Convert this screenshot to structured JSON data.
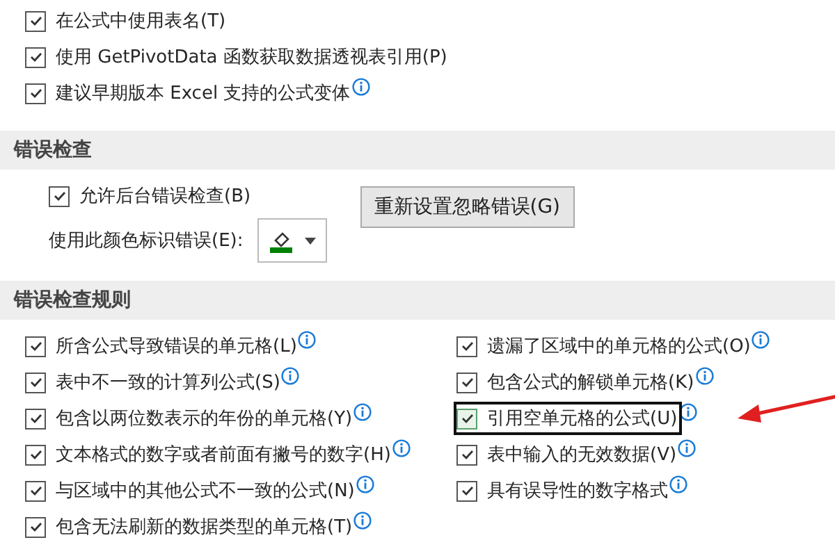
{
  "formula_options": [
    {
      "label": "在公式中使用表名(T)",
      "checked": true,
      "info": false
    },
    {
      "label": "使用 GetPivotData 函数获取数据透视表引用(P)",
      "checked": true,
      "info": false
    },
    {
      "label": "建议早期版本 Excel 支持的公式变体",
      "checked": true,
      "info": true
    }
  ],
  "error_checking": {
    "title": "错误检查",
    "background_check": {
      "label": "允许后台错误检查(B)",
      "checked": true
    },
    "color_label": "使用此颜色标识错误(E):",
    "color": "#008000",
    "reset_button": "重新设置忽略错误(G)"
  },
  "rules": {
    "title": "错误检查规则",
    "left": [
      {
        "label": "所含公式导致错误的单元格(L)",
        "checked": true,
        "focused": false,
        "annotated": false
      },
      {
        "label": "表中不一致的计算列公式(S)",
        "checked": true,
        "focused": false,
        "annotated": false
      },
      {
        "label": "包含以两位数表示的年份的单元格(Y)",
        "checked": true,
        "focused": false,
        "annotated": false
      },
      {
        "label": "文本格式的数字或者前面有撇号的数字(H)",
        "checked": true,
        "focused": false,
        "annotated": false
      },
      {
        "label": "与区域中的其他公式不一致的公式(N)",
        "checked": true,
        "focused": false,
        "annotated": false
      },
      {
        "label": "包含无法刷新的数据类型的单元格(T)",
        "checked": true,
        "focused": false,
        "annotated": false
      }
    ],
    "right": [
      {
        "label": "遗漏了区域中的单元格的公式(O)",
        "checked": true,
        "focused": false,
        "annotated": false
      },
      {
        "label": "包含公式的解锁单元格(K)",
        "checked": true,
        "focused": false,
        "annotated": false
      },
      {
        "label": "引用空单元格的公式(U)",
        "checked": true,
        "focused": true,
        "annotated": true
      },
      {
        "label": "表中输入的无效数据(V)",
        "checked": true,
        "focused": false,
        "annotated": false
      },
      {
        "label": "具有误导性的数字格式",
        "checked": true,
        "focused": false,
        "annotated": false
      }
    ]
  }
}
